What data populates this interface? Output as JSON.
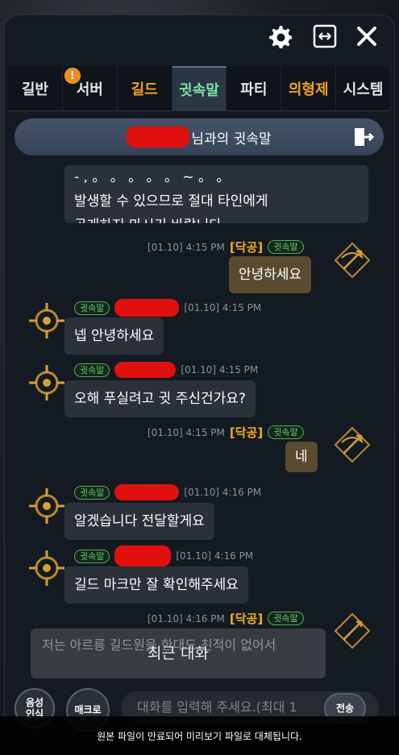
{
  "header": {
    "title_suffix": "님과의 귓속말"
  },
  "tabs": [
    {
      "label": "길반",
      "style": "normal"
    },
    {
      "label": "서버",
      "style": "normal",
      "badge": "!"
    },
    {
      "label": "길드",
      "style": "gold"
    },
    {
      "label": "귓속말",
      "style": "active"
    },
    {
      "label": "파티",
      "style": "normal"
    },
    {
      "label": "의형제",
      "style": "gold"
    },
    {
      "label": "시스템",
      "style": "normal"
    }
  ],
  "whisper_tag": "귓속말",
  "messages": {
    "system_notice": "- , 。 。 。 。 。 ~ 。 。\n발생할 수 있으므로 절대 타인에게\n공개하지 마시기 바랍니다.",
    "m1": {
      "time": "[01.10] 4:15 PM",
      "sender": "[닥공]",
      "text": "안녕하세요"
    },
    "m2": {
      "time": "[01.10] 4:15 PM",
      "text": "넵 안녕하세요"
    },
    "m3": {
      "time": "[01.10] 4:15 PM",
      "text": "오해 푸실려고 귓 주신건가요?"
    },
    "m4": {
      "time": "[01.10] 4:15 PM",
      "sender": "[닥공]",
      "text": "네"
    },
    "m5": {
      "time": "[01.10] 4:16 PM",
      "text": "알겠습니다 전달할게요"
    },
    "m6": {
      "time": "[01.10] 4:16 PM",
      "text": "길드 마크만 잘 확인해주세요"
    },
    "m7": {
      "time": "[01.10] 4:16 PM",
      "sender": "[닥공]"
    }
  },
  "recent": {
    "preview": "저는 아르릉 길드원을 한대도 친적이 없어서",
    "label": "최근 대화"
  },
  "bottom": {
    "voice_label": "음성\n인식",
    "macro_label": "매크로",
    "input_placeholder": "대화를 입력해 주세요.(최대 1",
    "send_label": "전송"
  },
  "notice": "원본 파일이 만료되어 미리보기 파일로 대체됩니다.",
  "colors": {
    "accent_gold": "#f2a31b",
    "whisper_green": "#5fd06e",
    "redaction": "#e0100f"
  }
}
